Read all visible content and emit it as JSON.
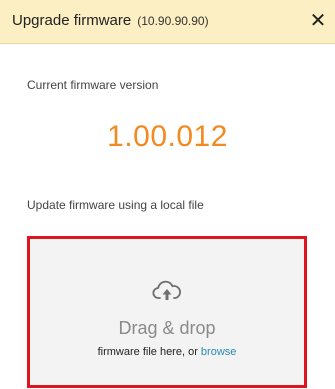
{
  "dialog": {
    "title": "Upgrade firmware",
    "device_ip": "(10.90.90.90)",
    "close_glyph": "✕",
    "colors": {
      "header_bg": "#fcefc3",
      "version": "#f28a21",
      "highlight_border": "#e0141e",
      "link": "#2a8bb0"
    }
  },
  "current": {
    "label": "Current firmware version",
    "version": "1.00.012"
  },
  "update": {
    "label": "Update firmware using a local file"
  },
  "dropzone": {
    "icon": "cloud-upload-icon",
    "title": "Drag & drop",
    "subtitle_prefix": "firmware file here, or ",
    "browse_label": "browse"
  }
}
